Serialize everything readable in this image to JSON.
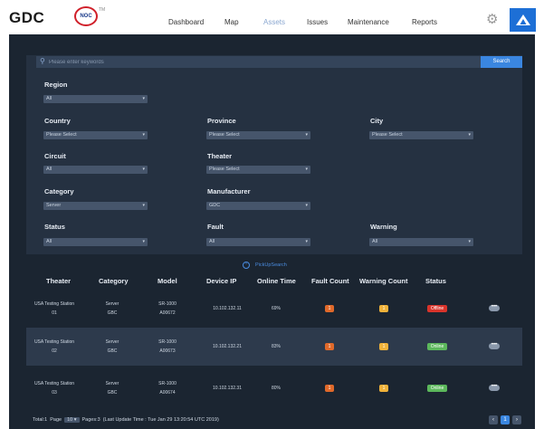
{
  "brand": {
    "name": "GDC",
    "noc_label": "NOC",
    "noc_sup": "TM"
  },
  "nav": {
    "items": [
      "Dashboard",
      "Map",
      "Assets",
      "Issues",
      "Maintenance",
      "Reports"
    ],
    "active": "Assets"
  },
  "search": {
    "placeholder": "Please enter keywords",
    "button": "Search"
  },
  "filters": {
    "region": {
      "label": "Region",
      "value": "All"
    },
    "country": {
      "label": "Country",
      "value": "Please Select"
    },
    "province": {
      "label": "Province",
      "value": "Please Select"
    },
    "city": {
      "label": "City",
      "value": "Please Select"
    },
    "circuit": {
      "label": "Circuit",
      "value": "All"
    },
    "theater": {
      "label": "Theater",
      "value": "Please Select"
    },
    "category": {
      "label": "Category",
      "value": "Server"
    },
    "manufacturer": {
      "label": "Manufacturer",
      "value": "GDC"
    },
    "status": {
      "label": "Status",
      "value": "All"
    },
    "fault": {
      "label": "Fault",
      "value": "All"
    },
    "warning": {
      "label": "Warning",
      "value": "All"
    }
  },
  "pickup": {
    "label": "PickUpSearch"
  },
  "table": {
    "headers": [
      "Theater",
      "Category",
      "Model",
      "Device IP",
      "Online Time",
      "Fault Count",
      "Warning Count",
      "Status"
    ],
    "rows": [
      {
        "theater": "USA Testing Station",
        "theater_no": "01",
        "category": "Server",
        "category_sub": "GBC",
        "model": "SR-1000",
        "model_sub": "A00672",
        "ip": "10.102.132.11",
        "online": "69%",
        "fault": "1",
        "warning": "1",
        "status": "Offline"
      },
      {
        "theater": "USA Testing Station",
        "theater_no": "02",
        "category": "Server",
        "category_sub": "GBC",
        "model": "SR-1000",
        "model_sub": "A00673",
        "ip": "10.102.132.21",
        "online": "83%",
        "fault": "1",
        "warning": "1",
        "status": "Online"
      },
      {
        "theater": "USA Testing Station",
        "theater_no": "03",
        "category": "Server",
        "category_sub": "GBC",
        "model": "SR-1000",
        "model_sub": "A00674",
        "ip": "10.102.132.31",
        "online": "80%",
        "fault": "1",
        "warning": "1",
        "status": "Online"
      }
    ],
    "more_icon": "•••"
  },
  "footer": {
    "total": "Total:1",
    "page_label": "Page",
    "page_size": "10",
    "pages": "Pages:3",
    "last_update": "(Last Update Time : Tue Jan 29 13:20:54 UTC 2019)",
    "current_page": "1"
  },
  "colors": {
    "accent": "#3a86e0",
    "fault": "#e0692a",
    "warning": "#f0b23a",
    "offline": "#d9342b",
    "online": "#5cb85c"
  }
}
